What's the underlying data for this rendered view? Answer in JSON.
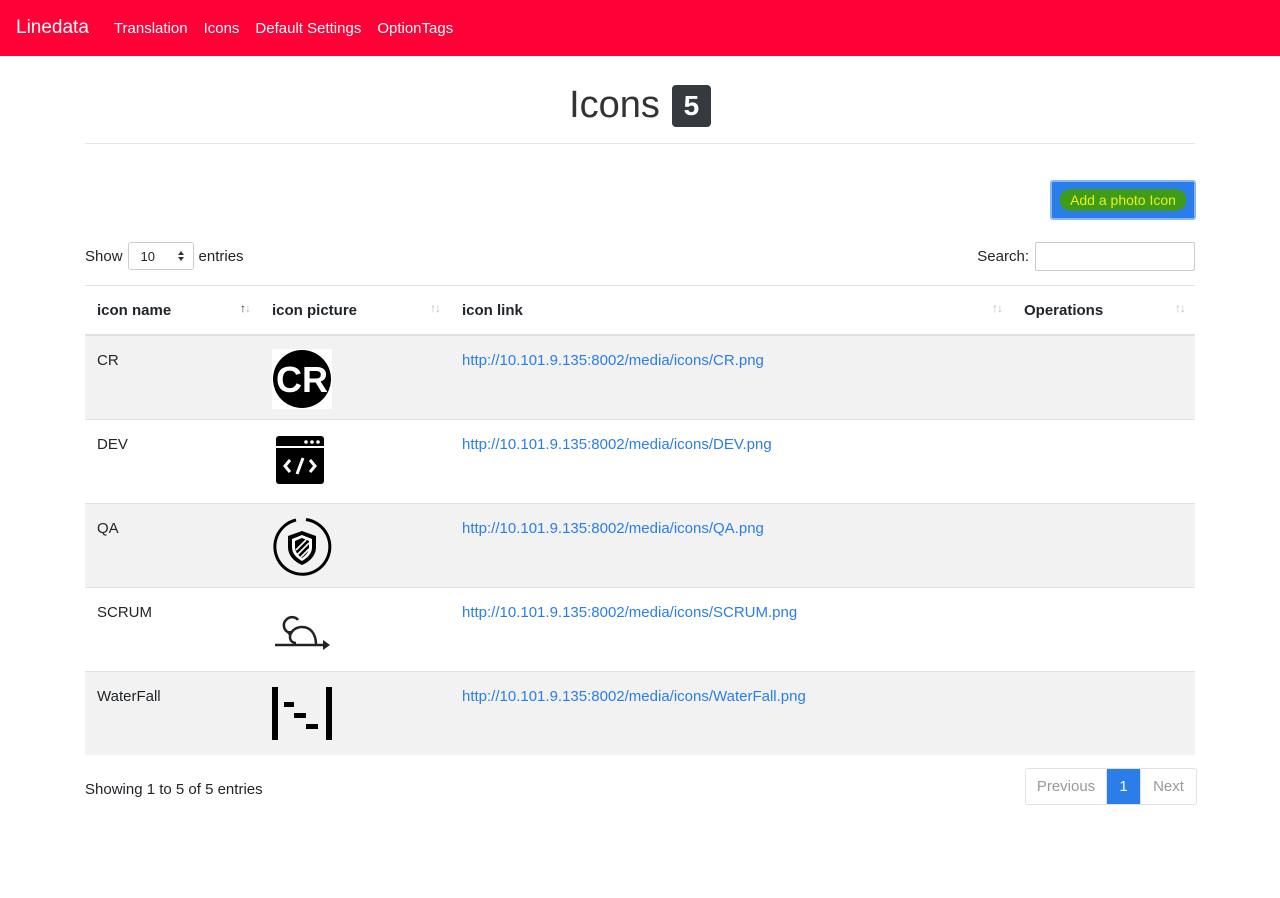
{
  "navbar": {
    "brand": "Linedata",
    "links": [
      "Translation",
      "Icons",
      "Default Settings",
      "OptionTags"
    ],
    "color": "#ff0037"
  },
  "header": {
    "title": "Icons",
    "count_badge": "5"
  },
  "actions": {
    "add_button": "Add a photo Icon"
  },
  "length_control": {
    "show_label": "Show",
    "value": "10",
    "entries_label": "entries"
  },
  "search": {
    "label": "Search:",
    "value": ""
  },
  "table": {
    "columns": [
      "icon name",
      "icon picture",
      "icon link",
      "Operations"
    ],
    "rows": [
      {
        "name": "CR",
        "icon": "cr-logo-icon",
        "link": "http://10.101.9.135:8002/media/icons/CR.png"
      },
      {
        "name": "DEV",
        "icon": "code-window-icon",
        "link": "http://10.101.9.135:8002/media/icons/DEV.png"
      },
      {
        "name": "QA",
        "icon": "shield-circle-icon",
        "link": "http://10.101.9.135:8002/media/icons/QA.png"
      },
      {
        "name": "SCRUM",
        "icon": "sprint-loop-icon",
        "link": "http://10.101.9.135:8002/media/icons/SCRUM.png"
      },
      {
        "name": "WaterFall",
        "icon": "waterfall-steps-icon",
        "link": "http://10.101.9.135:8002/media/icons/WaterFall.png"
      }
    ]
  },
  "footer": {
    "info": "Showing 1 to 5 of 5 entries",
    "pagination": {
      "previous": "Previous",
      "current": "1",
      "next": "Next"
    }
  },
  "colors": {
    "primary": "#2b7de9",
    "stripe": "#f2f2f2"
  }
}
